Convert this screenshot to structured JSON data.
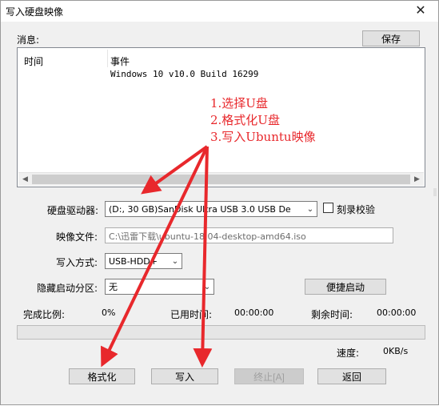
{
  "window": {
    "title": "写入硬盘映像",
    "close_glyph": "✕"
  },
  "messages": {
    "label": "消息:",
    "save_button": "保存",
    "columns": [
      "时间",
      "事件"
    ],
    "rows": [
      {
        "time": "",
        "event": "Windows 10 v10.0 Build 16299"
      }
    ]
  },
  "form": {
    "drive_label": "硬盘驱动器:",
    "drive_value": "(D:, 30 GB)SanDisk Ultra USB 3.0 USB De",
    "verify_label": "刻录校验",
    "image_label": "映像文件:",
    "image_value": "C:\\迅雷下载\\ubuntu-18.04-desktop-amd64.iso",
    "write_mode_label": "写入方式:",
    "write_mode_value": "USB-HDD+",
    "hidden_partition_label": "隐藏启动分区:",
    "hidden_partition_value": "无",
    "quick_boot_button": "便捷启动"
  },
  "status": {
    "complete_label": "完成比例:",
    "complete_value": "0%",
    "elapsed_label": "已用时间:",
    "elapsed_value": "00:00:00",
    "remaining_label": "剩余时间:",
    "remaining_value": "00:00:00",
    "progress": 0,
    "speed_label": "速度:",
    "speed_value": "0KB/s"
  },
  "buttons": {
    "format": "格式化",
    "write": "写入",
    "abort": "终止[A]",
    "back": "返回"
  },
  "annotation": {
    "lines": [
      "1.选择U盘",
      "2.格式化U盘",
      "3.写入Ubuntu映像"
    ],
    "color": "#e8282c"
  }
}
